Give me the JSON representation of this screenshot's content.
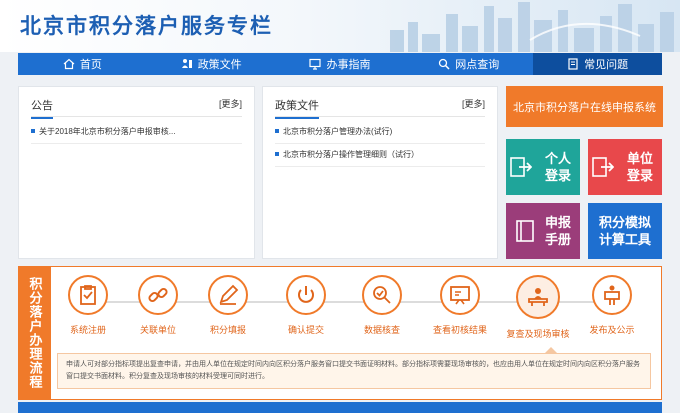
{
  "header": {
    "title": "北京市积分落户服务专栏"
  },
  "nav": [
    {
      "label": "首页",
      "icon": "home-icon"
    },
    {
      "label": "政策文件",
      "icon": "person-doc-icon"
    },
    {
      "label": "办事指南",
      "icon": "monitor-icon"
    },
    {
      "label": "网点查询",
      "icon": "search-icon"
    },
    {
      "label": "常见问题",
      "icon": "book-icon",
      "active": true
    }
  ],
  "notice": {
    "title": "公告",
    "more": "[更多]",
    "items": [
      "关于2018年北京市积分落户申报审核..."
    ]
  },
  "policy": {
    "title": "政策文件",
    "more": "[更多]",
    "items": [
      "北京市积分落户管理办法(试行)",
      "北京市积分落户操作管理细则（试行）"
    ]
  },
  "online": {
    "label": "北京市积分落户在线申报系统"
  },
  "tiles": [
    {
      "label": "个人登录",
      "color": "#1fa59a",
      "icon": "person-login-icon"
    },
    {
      "label": "单位登录",
      "color": "#e8484b",
      "icon": "company-login-icon"
    },
    {
      "label": "申报手册",
      "color": "#9b3d7a",
      "icon": "manual-icon"
    },
    {
      "label": "积分模拟计算工具",
      "color": "#1e6fd0"
    }
  ],
  "process": {
    "label": "积分落户办理流程",
    "steps": [
      "系统注册",
      "关联单位",
      "积分填报",
      "确认提交",
      "数据核查",
      "查看初核结果",
      "复查及现场审核",
      "发布及公示"
    ],
    "description": "申请人可对部分指标项提出复查申请，并由用人单位在规定时间内向区积分落户服务窗口提交书面证明材料。部分指标项需要现场审核的，也应由用人单位在规定时间内向区积分落户服务窗口提交书面材料。积分复查及现场审核的材料受理可同时进行。"
  },
  "colors": {
    "primary": "#1e6fd0",
    "accent": "#f07a2a"
  }
}
